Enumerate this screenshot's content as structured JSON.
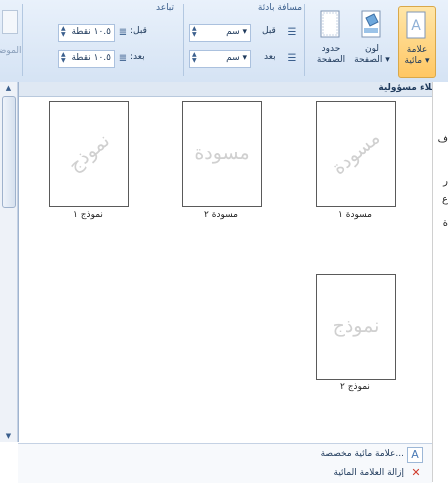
{
  "ribbon": {
    "page_background": {
      "watermark_label": "علامة\nمائية ▾",
      "page_color_label": "لون\nالصفحة ▾",
      "page_borders_label": "حدود\nالصفحة"
    },
    "spacing_group": {
      "title": "مسافة بادئة",
      "before_label": "قبل",
      "before_value": "سم ▾",
      "after_label": "بعد",
      "after_value": "سم ▾"
    },
    "paragraph_spacing": {
      "title": "تباعد",
      "before_label": "قبل:",
      "before_value": "١٠.٥ نقطة",
      "after_label": "بعد:",
      "after_value": "١٠.٥ نقطة"
    },
    "position_label": "الموضع"
  },
  "gallery": {
    "section_header": "إخلاء مسؤولية",
    "items": [
      {
        "label": "مسودة ١",
        "watermark": "مسودة",
        "rotated": true
      },
      {
        "label": "مسودة ٢",
        "watermark": "مسودة",
        "rotated": false
      },
      {
        "label": "نموذج ١",
        "watermark": "نموذج",
        "rotated": true
      },
      {
        "label": "نموذج ٢",
        "watermark": "نموذج",
        "rotated": false
      }
    ]
  },
  "menu": {
    "custom_watermark": "علامة مائية مخصصة...",
    "remove_watermark": "إزالة العلامة المائية"
  },
  "right_strip_glyphs": [
    "ف",
    "ر",
    "ع",
    "ة"
  ]
}
